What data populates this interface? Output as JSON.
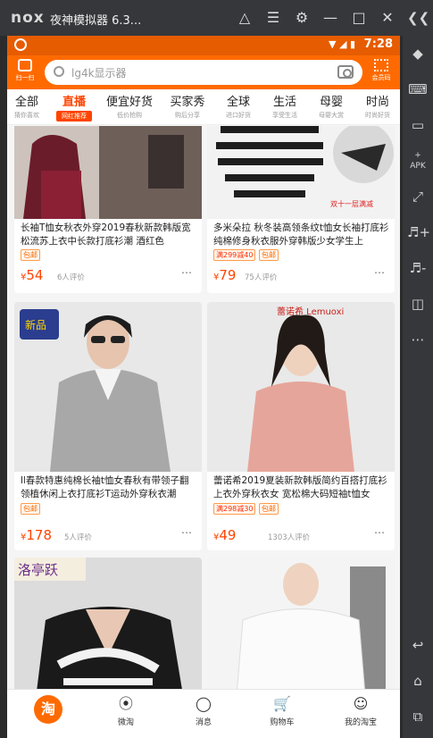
{
  "emulator": {
    "logo": "nox",
    "title": "夜神模拟器 6.3...",
    "controls": [
      "shirt-icon",
      "menu-icon",
      "gear-icon",
      "minimize-icon",
      "maximize-icon",
      "close-icon",
      "collapse-icon"
    ],
    "side_tools": [
      "pin-icon",
      "keyboard-icon",
      "screen-icon",
      "apk-icon",
      "fullscreen-icon",
      "volume-up-icon",
      "volume-down-icon",
      "trash-icon",
      "more-icon",
      "back-icon",
      "home-icon",
      "recents-icon"
    ],
    "apk_label": "APK"
  },
  "status_bar": {
    "time": "7:28",
    "accent": "#e65c00"
  },
  "header": {
    "scan_label": "扫一扫",
    "search_placeholder": "lg4k显示器",
    "qr_label": "会员码",
    "accent": "#ff6a00"
  },
  "categories": [
    {
      "name": "全部",
      "sub": "猜你喜欢",
      "active": false
    },
    {
      "name": "直播",
      "sub": "网红推荐",
      "active": true
    },
    {
      "name": "便宜好货",
      "sub": "低价抢购",
      "active": false
    },
    {
      "name": "买家秀",
      "sub": "购后分享",
      "active": false
    },
    {
      "name": "全球",
      "sub": "进口好货",
      "active": false
    },
    {
      "name": "生活",
      "sub": "享受生活",
      "active": false
    },
    {
      "name": "母婴",
      "sub": "母婴大赏",
      "active": false
    },
    {
      "name": "时尚",
      "sub": "时尚好货",
      "active": false
    }
  ],
  "products": [
    {
      "title": "长袖T恤女秋衣外穿2019春秋新款韩版宽松流苏上衣中长款打底衫潮 酒红色",
      "tag": "包邮",
      "price": "54",
      "reviews": "6人评价"
    },
    {
      "title": "多米朵拉 秋冬装高领条纹t恤女长袖打底衫纯棉修身秋衣服外穿韩版少女学生上",
      "tag": "满299减40",
      "tag_extra": "包邮",
      "price": "79",
      "reviews": "75人评价",
      "overlay_text": "双十一层满减"
    },
    {
      "title": "ll春款特惠纯棉长袖t恤女春秋有带领子翻领植休闲上衣打底衫T运动外穿秋衣潮",
      "tag": "包邮",
      "price": "178",
      "reviews": "5人评价",
      "overlay_text": "新品"
    },
    {
      "title": "蕾诺希2019夏装新款韩版简约百搭打底衫上衣外穿秋衣女 宽松棉大码短袖t恤女",
      "tag": "满298减30",
      "tag_extra": "包邮",
      "price": "49",
      "reviews": "1303人评价",
      "overlay_text": "蕾诺希 Lemuoxi"
    },
    {
      "title": "",
      "overlay_text": "洛亭跃"
    },
    {
      "title": ""
    }
  ],
  "currency": "¥",
  "tabs": [
    {
      "label": "",
      "icon": "taobao-home-icon",
      "badge": "淘"
    },
    {
      "label": "微淘",
      "icon": "broadcast-icon"
    },
    {
      "label": "消息",
      "icon": "message-icon"
    },
    {
      "label": "购物车",
      "icon": "cart-icon"
    },
    {
      "label": "我的淘宝",
      "icon": "user-icon"
    }
  ]
}
